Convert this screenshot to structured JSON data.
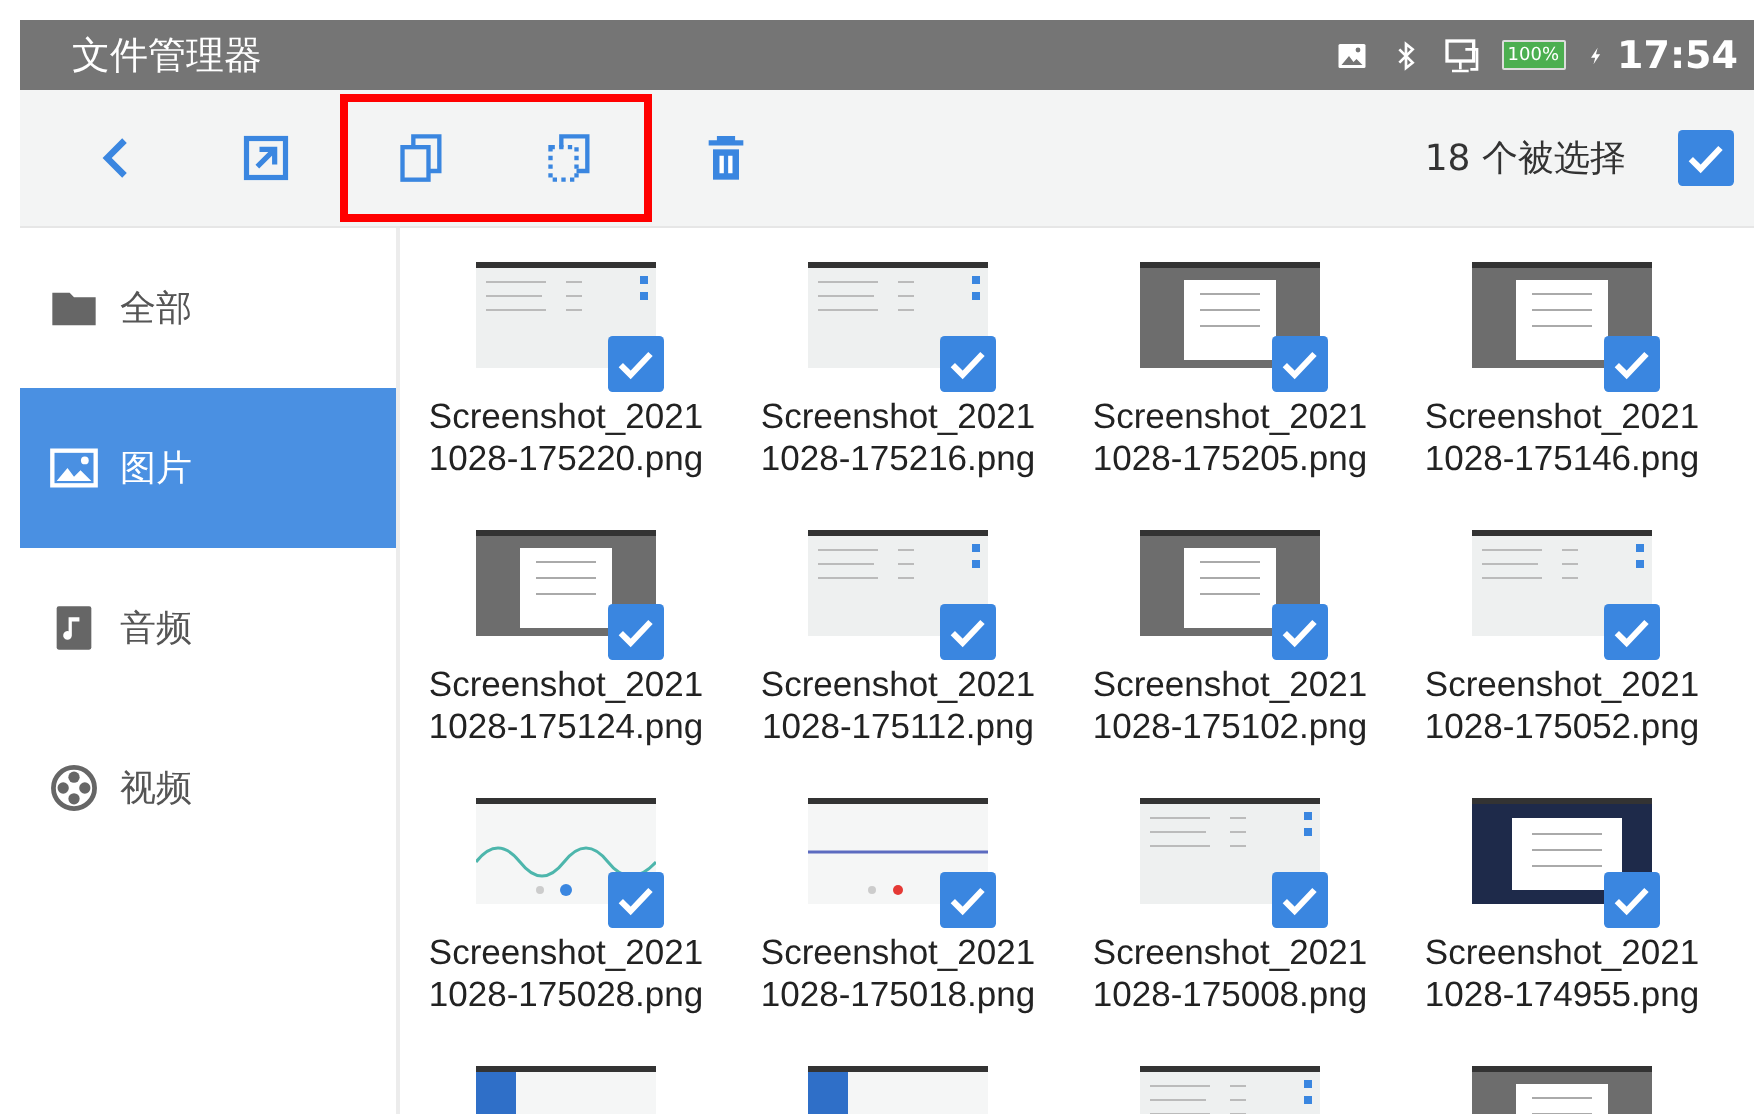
{
  "status_bar": {
    "title": "文件管理器",
    "battery": "100%",
    "time": "17:54"
  },
  "toolbar": {
    "actions": [
      {
        "kind": "back",
        "highlighted": false
      },
      {
        "kind": "open",
        "highlighted": false
      },
      {
        "kind": "copy",
        "highlighted": true
      },
      {
        "kind": "move",
        "highlighted": true
      },
      {
        "kind": "delete",
        "highlighted": false
      }
    ],
    "count": "18 个被选择",
    "select_all": {
      "checked": true
    }
  },
  "sidebar": {
    "items": [
      {
        "kind": "folder",
        "label": "全部",
        "selected": false
      },
      {
        "kind": "image",
        "label": "图片",
        "selected": true
      },
      {
        "kind": "music",
        "label": "音频",
        "selected": false
      },
      {
        "kind": "video",
        "label": "视频",
        "selected": false
      }
    ]
  },
  "files": [
    {
      "kind": "list",
      "name": [
        "Screenshot_2021",
        "1028-175220.png"
      ],
      "selected": true
    },
    {
      "kind": "list",
      "name": [
        "Screenshot_2021",
        "1028-175216.png"
      ],
      "selected": true
    },
    {
      "kind": "dialog",
      "name": [
        "Screenshot_2021",
        "1028-175205.png"
      ],
      "selected": true
    },
    {
      "kind": "dialog",
      "name": [
        "Screenshot_2021",
        "1028-175146.png"
      ],
      "selected": true
    },
    {
      "kind": "dialog",
      "name": [
        "Screenshot_2021",
        "1028-175124.png"
      ],
      "selected": true
    },
    {
      "kind": "list",
      "name": [
        "Screenshot_2021",
        "1028-175112.png"
      ],
      "selected": true
    },
    {
      "kind": "dialog",
      "name": [
        "Screenshot_2021",
        "1028-175102.png"
      ],
      "selected": true
    },
    {
      "kind": "list",
      "name": [
        "Screenshot_2021",
        "1028-175052.png"
      ],
      "selected": true
    },
    {
      "kind": "wave",
      "name": [
        "Screenshot_2021",
        "1028-175028.png"
      ],
      "selected": true
    },
    {
      "kind": "record",
      "name": [
        "Screenshot_2021",
        "1028-175018.png"
      ],
      "selected": true
    },
    {
      "kind": "list",
      "name": [
        "Screenshot_2021",
        "1028-175008.png"
      ],
      "selected": true
    },
    {
      "kind": "night",
      "name": [
        "Screenshot_2021",
        "1028-174955.png"
      ],
      "selected": true
    }
  ],
  "partial_row": [
    {
      "kind": "blue"
    },
    {
      "kind": "blue"
    },
    {
      "kind": "list"
    },
    {
      "kind": "dialog"
    }
  ]
}
